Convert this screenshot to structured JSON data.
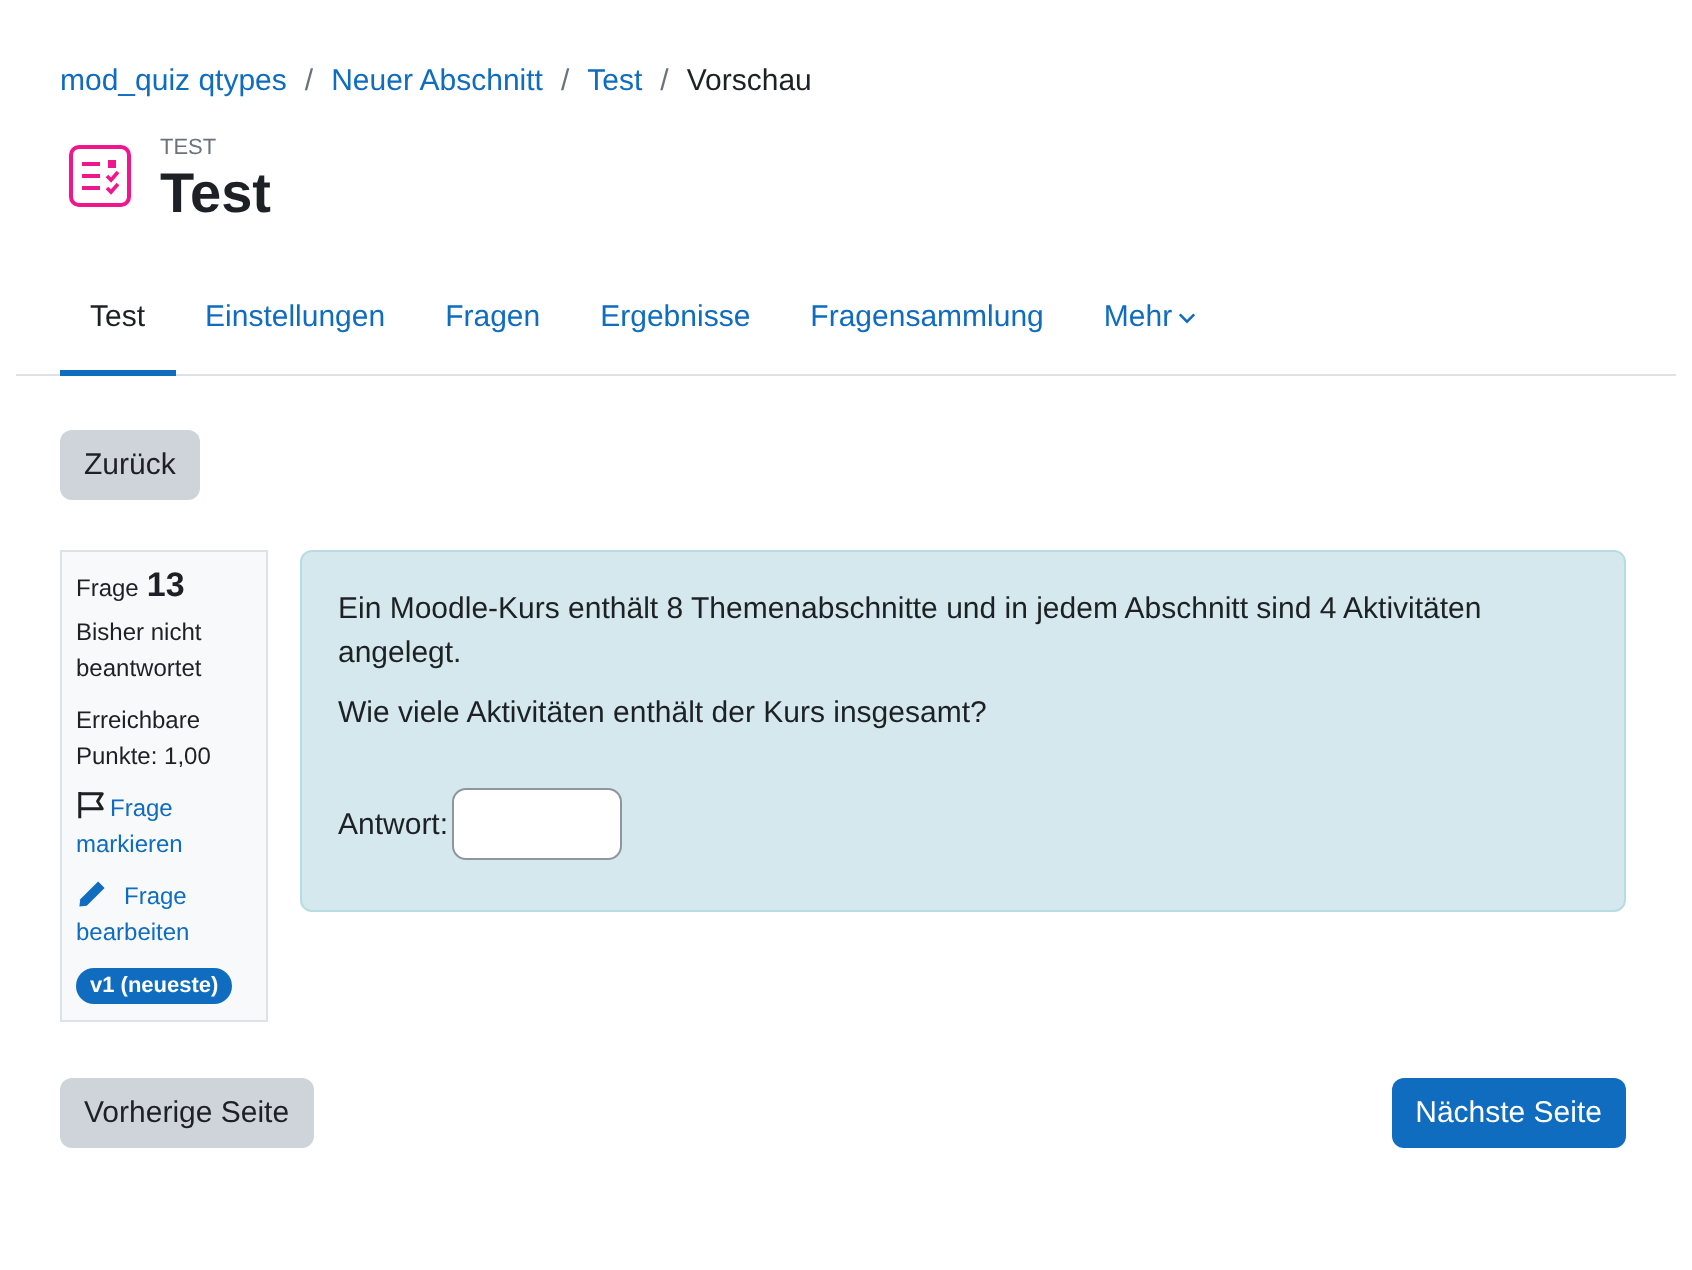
{
  "breadcrumb": [
    {
      "label": "mod_quiz qtypes",
      "current": false
    },
    {
      "separator": "/",
      "label": "Neuer Abschnitt",
      "current": false
    },
    {
      "separator": "/",
      "label": "Test",
      "current": false
    },
    {
      "separator": "/",
      "label": "Vorschau",
      "current": true
    }
  ],
  "header": {
    "eyebrow": "TEST",
    "title": "Test"
  },
  "tabs": [
    {
      "label": "Test",
      "selected": true,
      "kind": "link"
    },
    {
      "label": "Einstellungen",
      "selected": false,
      "kind": "link"
    },
    {
      "label": "Fragen",
      "selected": false,
      "kind": "link"
    },
    {
      "label": "Ergebnisse",
      "selected": false,
      "kind": "link"
    },
    {
      "label": "Fragensammlung",
      "selected": false,
      "kind": "link"
    },
    {
      "label": "Mehr",
      "selected": false,
      "kind": "dropdown"
    }
  ],
  "back_button": "Zurück",
  "question_info": {
    "label": "Frage",
    "number": "13",
    "status": "Bisher nicht beantwortet",
    "points": "Erreichbare Punkte: 1,00",
    "flag_link": "Frage markieren",
    "edit_link": "Frage bearbeiten",
    "version_badge": "v1 (neueste)"
  },
  "question": {
    "paragraphs": [
      "Ein Moodle-Kurs enthält 8 Themenabschnitte und in jedem Abschnitt sind 4 Aktivitäten angelegt.",
      "Wie viele Aktivitäten enthält der Kurs insgesamt?"
    ],
    "answer_label": "Antwort:"
  },
  "navigation": {
    "previous": "Vorherige Seite",
    "next": "Nächste Seite"
  }
}
